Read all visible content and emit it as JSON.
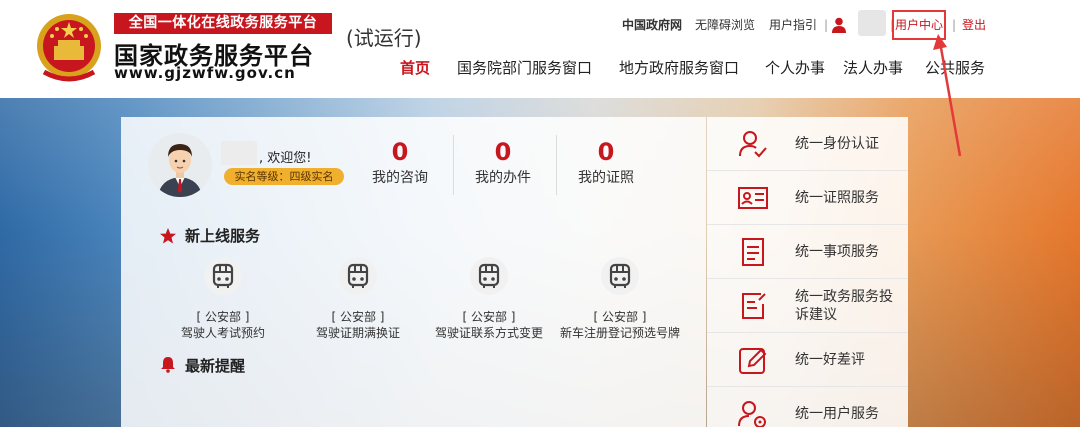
{
  "brand": {
    "top_banner": "全国一体化在线政务服务平台",
    "name": "国家政务服务平台",
    "url": "www.gjzwfw.gov.cn",
    "trial": "(试运行)"
  },
  "toplinks": {
    "gov_site": "中国政府网",
    "accessible": "无障碍浏览",
    "guide": "用户指引",
    "separator": "|",
    "user_center": "用户中心",
    "logout": "登出"
  },
  "nav": {
    "items": [
      {
        "label": "首页"
      },
      {
        "label": "国务院部门服务窗口"
      },
      {
        "label": "地方政府服务窗口"
      },
      {
        "label": "个人办事"
      },
      {
        "label": "法人办事"
      },
      {
        "label": "公共服务"
      }
    ]
  },
  "user": {
    "welcome": ", 欢迎您!",
    "level_badge": "实名等级：四级实名"
  },
  "stats": [
    {
      "value": "0",
      "label": "我的咨询"
    },
    {
      "value": "0",
      "label": "我的办件"
    },
    {
      "value": "0",
      "label": "我的证照"
    }
  ],
  "sections": {
    "new_services": "新上线服务",
    "latest_reminders": "最新提醒"
  },
  "services": [
    {
      "dept": "[ 公安部 ]",
      "name": "驾驶人考试预约"
    },
    {
      "dept": "[ 公安部 ]",
      "name": "驾驶证期满换证"
    },
    {
      "dept": "[ 公安部 ]",
      "name": "驾驶证联系方式变更"
    },
    {
      "dept": "[ 公安部 ]",
      "name": "新车注册登记预选号牌"
    }
  ],
  "sidebar": {
    "items": [
      {
        "label": "统一身份认证",
        "icon": "identity-icon"
      },
      {
        "label": "统一证照服务",
        "icon": "license-card-icon"
      },
      {
        "label": "统一事项服务",
        "icon": "document-icon"
      },
      {
        "label": "统一政务服务投诉建议",
        "icon": "complaint-icon"
      },
      {
        "label": "统一好差评",
        "icon": "edit-rating-icon"
      },
      {
        "label": "统一用户服务",
        "icon": "user-settings-icon"
      }
    ]
  },
  "colors": {
    "brand_red": "#c8161e",
    "badge_gold": "#f0b02d",
    "annotation_red": "#e23a3a"
  }
}
